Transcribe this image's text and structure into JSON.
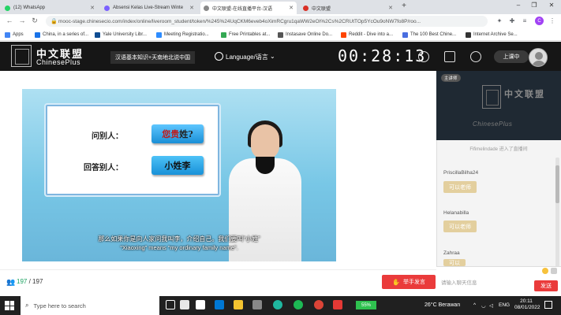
{
  "browser": {
    "tabs": [
      {
        "title": "(12) WhatsApp",
        "color": "#25d366"
      },
      {
        "title": "Absensi Kelas Live-Stream Winte",
        "color": "#7b61ff"
      },
      {
        "title": "中文联盟-在线直播平台-汉语",
        "color": "#888888"
      },
      {
        "title": "中文联盟",
        "color": "#d93025"
      }
    ],
    "new_tab": "+",
    "url": "mooc-stage.chinesecio.com/index/online/liveroom_student/token/%245%24UqCKM6eveb4oXimRCgru1qaWW2eOI%2Cs%2CRUtTOp5YcOu9oNW7fo8P/roo...",
    "bookmarks": [
      {
        "label": "Apps",
        "color": "#4285f4"
      },
      {
        "label": "China, in a series of...",
        "color": "#1a73e8"
      },
      {
        "label": "Yale University Libr...",
        "color": "#0f4d92"
      },
      {
        "label": "Meeting Registratio...",
        "color": "#2d8cff"
      },
      {
        "label": "Free Printables at...",
        "color": "#34a853"
      },
      {
        "label": "Instasave Online Do...",
        "color": "#555555"
      },
      {
        "label": "Reddit - Dive into a...",
        "color": "#ff4500"
      },
      {
        "label": "The 100 Best Chine...",
        "color": "#4a6ee0"
      },
      {
        "label": "Internet Archive Se...",
        "color": "#333333"
      }
    ],
    "profile_initial": "C"
  },
  "header": {
    "brand_cn": "中文联盟",
    "brand_en": "ChinesePlus",
    "course_title": "汉语基本知识+天南地北说中国",
    "language_label": "Language/语言",
    "timer": "00:28:13",
    "class_status": "上课中"
  },
  "video": {
    "ask_label": "问别人：",
    "ask_parts": [
      "您",
      "贵",
      "姓",
      "?"
    ],
    "answer_label": "回答别人：",
    "answer_text": "小姓李",
    "subtitle_cn": "那么如果你是向人家问我叫李，介绍自己。我们要叫“小姓”",
    "subtitle_en": "“Xiaoxing”   means   “my ordinary family name”."
  },
  "footer": {
    "online_count": "197",
    "total_count": "/ 197",
    "raise_hand": "举手发言"
  },
  "side": {
    "badge": "主讲师",
    "logo_cn": "中文联盟",
    "logo_en": "ChinesePlus",
    "join_message": "Fifimelindade 进入了直播间",
    "messages": [
      {
        "name": "PriscillaBilha24",
        "text": "可以老师"
      },
      {
        "name": "Helanabilla",
        "text": "可以老师"
      },
      {
        "name": "Zahraa",
        "text": "可以"
      }
    ],
    "input_placeholder": "请输入聊天信息",
    "send_label": "发送"
  },
  "taskbar": {
    "search_placeholder": "Type here to search",
    "battery": "55%",
    "weather": "26°C  Berawan",
    "lang": "ENG",
    "time": "20:11",
    "date": "08/01/2022"
  }
}
